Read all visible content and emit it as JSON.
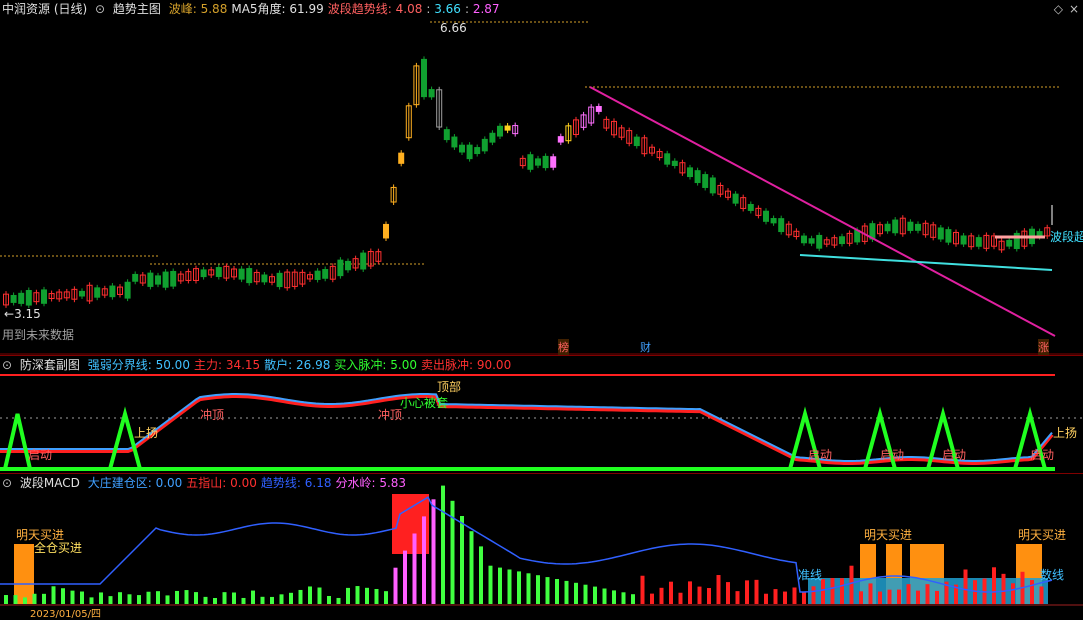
{
  "top": {
    "title": "中润资源 (日线)",
    "indicator": "趋势主图",
    "items": [
      {
        "label": "波峰:",
        "value": "5.88",
        "label_color": "#d4a02a",
        "value_color": "#d4a02a"
      },
      {
        "label": "MA5角度:",
        "value": "61.99",
        "label_color": "#e0e0e0",
        "value_color": "#e0e0e0"
      },
      {
        "label": "波段趋势线:",
        "value": "4.08",
        "label_color": "#ff6060",
        "value_color": "#ff6060"
      },
      {
        "label": ":",
        "value": "3.66",
        "label_color": "#c0c0c0",
        "value_color": "#40e0ff"
      },
      {
        "label": ":",
        "value": "2.87",
        "label_color": "#c0c0c0",
        "value_color": "#ff60ff"
      }
    ],
    "high_label": "6.66",
    "low_label": "3.15",
    "future_note": "用到未来数据",
    "trend_label": "波段超",
    "tags": [
      "榜",
      "财",
      "涨"
    ]
  },
  "mid": {
    "title": "防深套副图",
    "items": [
      {
        "label": "强弱分界线:",
        "value": "50.00",
        "color": "#40c0ff"
      },
      {
        "label": "主力:",
        "value": "34.15",
        "color": "#ff3030"
      },
      {
        "label": "散户:",
        "value": "26.98",
        "color": "#40c0ff"
      },
      {
        "label": "买入脉冲:",
        "value": "5.00",
        "color": "#30ff30"
      },
      {
        "label": "卖出脉冲:",
        "value": "90.00",
        "color": "#ff3030"
      }
    ],
    "annotations": [
      "上扬",
      "冲顶",
      "冲顶",
      "小心被套",
      "顶部",
      "启动",
      "启动",
      "启动",
      "启动",
      "启动",
      "上扬"
    ]
  },
  "bot": {
    "title": "波段MACD",
    "items": [
      {
        "label": "大庄建仓区:",
        "value": "0.00",
        "color": "#40a0ff"
      },
      {
        "label": "五指山:",
        "value": "0.00",
        "color": "#ff3030"
      },
      {
        "label": "趋势线:",
        "value": "6.18",
        "color": "#3060ff"
      },
      {
        "label": "分水岭:",
        "value": "5.83",
        "color": "#ff60ff"
      }
    ],
    "annotations": [
      "明天买进",
      "全仓买进",
      "明天买进",
      "明天买进",
      "准线",
      "数线"
    ],
    "date_label": "2023/01/05/四"
  },
  "colors": {
    "up": "#ff3030",
    "down": "#10a030",
    "bg": "#000000"
  }
}
